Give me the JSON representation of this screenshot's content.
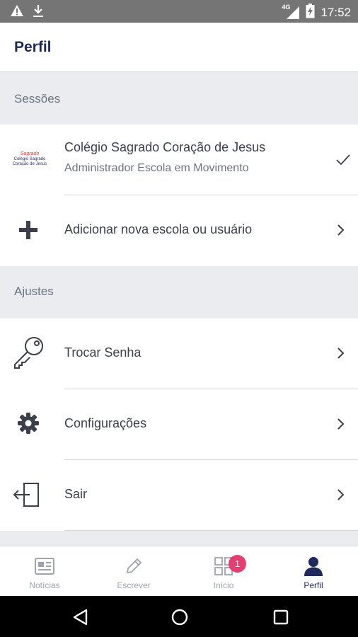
{
  "status_bar": {
    "time": "17:52",
    "network": "4G",
    "icons": [
      "warning-icon",
      "download-icon",
      "signal-icon",
      "battery-charging-icon"
    ]
  },
  "header": {
    "title": "Perfil"
  },
  "sections": {
    "sessions_title": "Sessões",
    "settings_title": "Ajustes"
  },
  "school": {
    "name": "Colégio Sagrado Coração de Jesus",
    "role": "Administrador Escola em Movimento",
    "logo_text_top": "Sagrado",
    "logo_text_line1": "Colégio Sagrado",
    "logo_text_line2": "Coração de Jesus",
    "selected_icon": "check-icon"
  },
  "rows": {
    "add_school": "Adicionar nova escola ou usuário",
    "change_password": "Trocar Senha",
    "settings": "Configurações",
    "logout": "Sair"
  },
  "bottom_nav": {
    "items": [
      {
        "label": "Notícias",
        "icon": "newspaper-icon"
      },
      {
        "label": "Escrever",
        "icon": "pencil-icon"
      },
      {
        "label": "Início",
        "icon": "grid-icon",
        "badge": "1"
      },
      {
        "label": "Perfil",
        "icon": "person-icon",
        "active": true
      }
    ]
  },
  "colors": {
    "brand_navy": "#1f2a5c",
    "badge": "#e43f73",
    "status_bar": "#757575",
    "background": "#ebecef"
  }
}
